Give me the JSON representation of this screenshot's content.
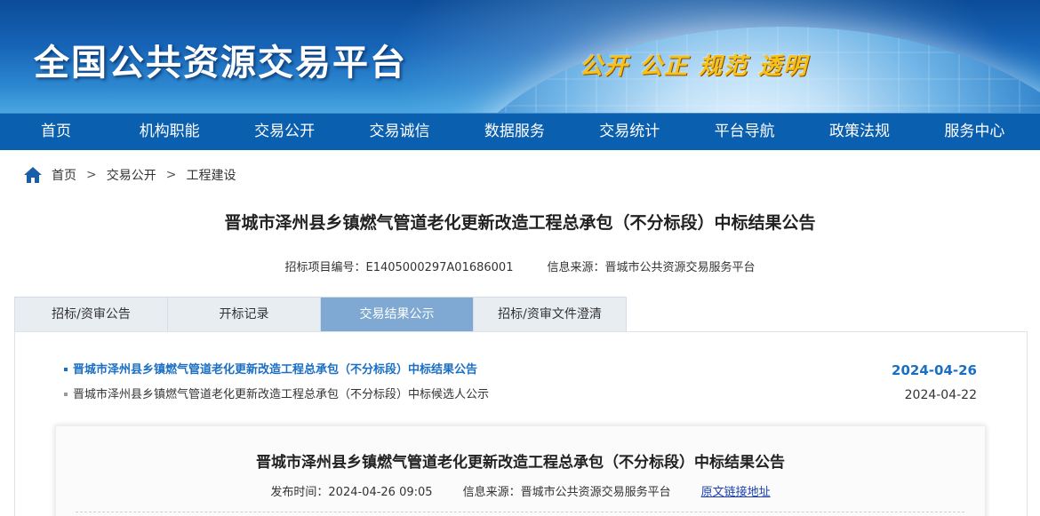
{
  "header": {
    "site_title": "全国公共资源交易平台",
    "slogan": "公开 公正 规范 透明"
  },
  "nav": {
    "items": [
      "首页",
      "机构职能",
      "交易公开",
      "交易诚信",
      "数据服务",
      "交易统计",
      "平台导航",
      "政策法规",
      "服务中心"
    ]
  },
  "breadcrumb": {
    "items": [
      "首页",
      "交易公开",
      "工程建设"
    ],
    "separator": ">"
  },
  "page": {
    "title": "晋城市泽州县乡镇燃气管道老化更新改造工程总承包（不分标段）中标结果公告",
    "project_no": "招标项目编号：E1405000297A01686001",
    "source": "信息来源：晋城市公共资源交易服务平台"
  },
  "tabs": [
    {
      "label": "招标/资审公告",
      "active": false
    },
    {
      "label": "开标记录",
      "active": false
    },
    {
      "label": "交易结果公示",
      "active": true
    },
    {
      "label": "招标/资审文件澄清",
      "active": false
    }
  ],
  "list": [
    {
      "title": "晋城市泽州县乡镇燃气管道老化更新改造工程总承包（不分标段）中标结果公告",
      "date": "2024-04-26",
      "active": true
    },
    {
      "title": "晋城市泽州县乡镇燃气管道老化更新改造工程总承包（不分标段）中标候选人公示",
      "date": "2024-04-22",
      "active": false
    }
  ],
  "detail": {
    "title": "晋城市泽州县乡镇燃气管道老化更新改造工程总承包（不分标段）中标结果公告",
    "publish_time": "发布时间：2024-04-26 09:05",
    "source": "信息来源：晋城市公共资源交易服务平台",
    "link_label": "原文链接地址"
  },
  "colors": {
    "nav_bg": "#0a5fae",
    "active_tab": "#7fa9d2",
    "active_link": "#1a6fc4",
    "slogan": "#f5c21a"
  }
}
